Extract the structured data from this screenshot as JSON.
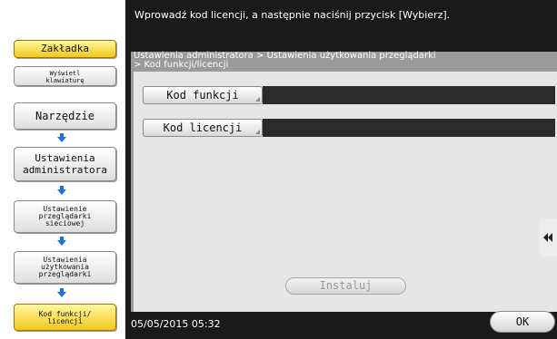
{
  "sidebar": {
    "tab_label": "Zakładka",
    "keyboard_label": "Wyświetl\nklawiaturę",
    "items": [
      {
        "label": "Narzędzie"
      },
      {
        "label": "Ustawienia\nadministratora"
      },
      {
        "label": "Ustawienie\nprzeglądarki\nsieciowej"
      },
      {
        "label": "Ustawienia\nużytkowania\nprzeglądarki"
      },
      {
        "label": "Kod funkcji/\nlicencji"
      }
    ],
    "arrow_color": "#1f6fe0",
    "highlight_color": "#f1c81c"
  },
  "header": {
    "message": "Wprowadź kod licencji, a następnie naciśnij przycisk [Wybierz]."
  },
  "breadcrumb": "Ustawienia administratora > Ustawienia użytkowania przeglądarki\n> Kod funkcji/licencji",
  "fields": {
    "function_code": {
      "label": "Kod funkcji",
      "value": ""
    },
    "license_code": {
      "label": "Kod licencji",
      "value": ""
    }
  },
  "actions": {
    "install_label": "Instaluj",
    "ok_label": "OK"
  },
  "status": {
    "datetime": "05/05/2015  05:32"
  },
  "side_tab_icon": "double-arrow-left-icon"
}
